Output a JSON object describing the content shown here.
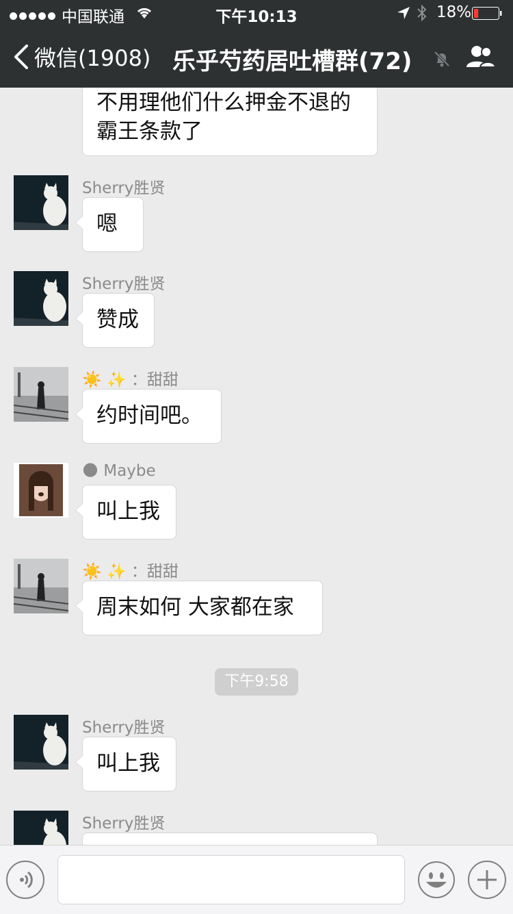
{
  "status_bar": {
    "carrier": "中国联通",
    "time": "下午10:13",
    "battery": "18%",
    "battery_level": 0.18
  },
  "nav": {
    "back_label": "微信(1908)",
    "title": "乐乎芍药居吐槽群(72)"
  },
  "messages": [
    {
      "sender": "",
      "text_line1": "不用理他们什么押金不退的",
      "text_line2": "霸王条款了"
    },
    {
      "sender": "Sherry胜贤",
      "text": "嗯"
    },
    {
      "sender": "Sherry胜贤",
      "text": "赞成"
    },
    {
      "sender": "：甜甜",
      "sender_prefix": "☀️ ✨",
      "text": "约时间吧。"
    },
    {
      "sender": "Maybe",
      "sender_prefix": "🌑",
      "text": "叫上我"
    },
    {
      "sender": "：甜甜",
      "sender_prefix": "☀️ ✨",
      "text": "周末如何 大家都在家"
    },
    {
      "sender": "Sherry胜贤",
      "text": "叫上我"
    },
    {
      "sender": "Sherry胜贤",
      "text": ""
    }
  ],
  "timestamp": "下午9:58",
  "colors": {
    "nav_bg": "#2e3132",
    "chat_bg": "#ebebeb",
    "battery_red": "#ff3b30"
  },
  "icons": [
    "signal-icon",
    "wifi-icon",
    "location-icon",
    "bluetooth-icon",
    "battery-icon",
    "back-chevron-icon",
    "mute-icon",
    "people-icon",
    "voice-icon",
    "emoji-icon",
    "plus-icon"
  ]
}
